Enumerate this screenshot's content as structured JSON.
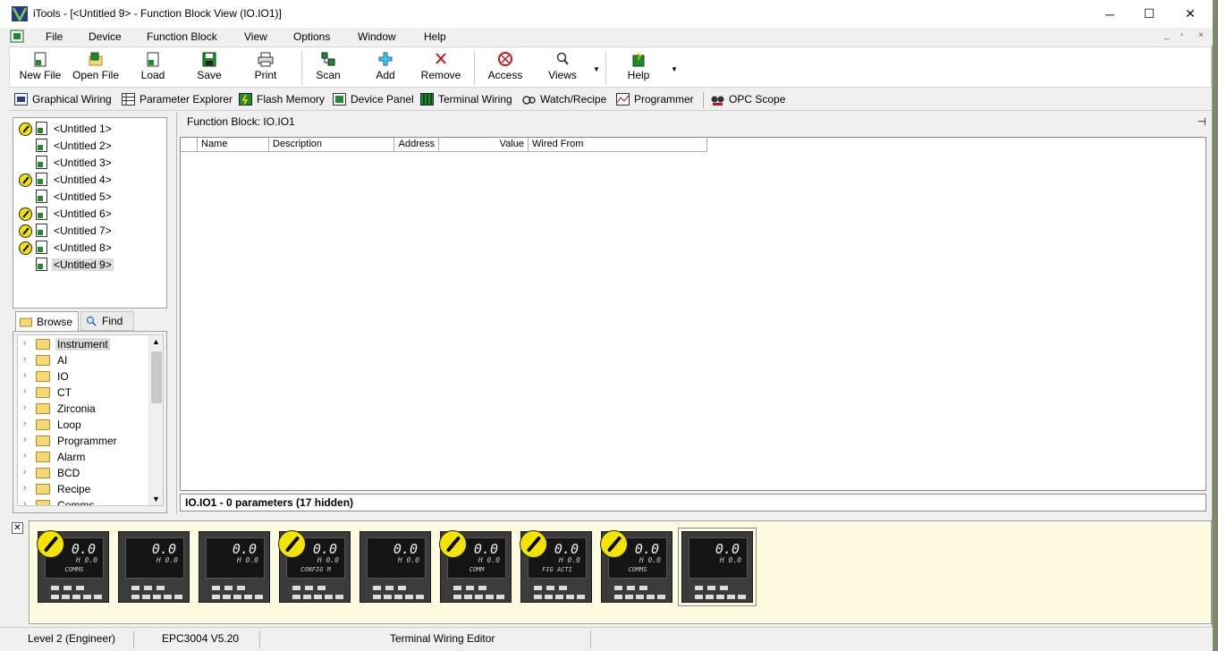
{
  "window": {
    "title": "iTools - [<Untitled 9> - Function Block View (IO.IO1)]",
    "controls": {
      "minimize": "─",
      "maximize": "☐",
      "close": "✕"
    }
  },
  "menu": {
    "items": [
      "File",
      "Device",
      "Function Block",
      "View",
      "Options",
      "Window",
      "Help"
    ],
    "mdi": {
      "minimize": "_",
      "restore": "▫",
      "close": "×"
    }
  },
  "toolbar": {
    "new_file": "New File",
    "open_file": "Open File",
    "load": "Load",
    "save": "Save",
    "print": "Print",
    "scan": "Scan",
    "add": "Add",
    "remove": "Remove",
    "access": "Access",
    "views": "Views",
    "help": "Help"
  },
  "viewbar": {
    "graphical_wiring": "Graphical Wiring",
    "parameter_explorer": "Parameter Explorer",
    "flash_memory": "Flash Memory",
    "device_panel": "Device Panel",
    "terminal_wiring": "Terminal Wiring",
    "watch_recipe": "Watch/Recipe",
    "programmer": "Programmer",
    "opc_scope": "OPC Scope"
  },
  "devices": [
    {
      "label": "<Untitled 1>",
      "wrench": true
    },
    {
      "label": "<Untitled 2>",
      "wrench": false
    },
    {
      "label": "<Untitled 3>",
      "wrench": false
    },
    {
      "label": "<Untitled 4>",
      "wrench": true
    },
    {
      "label": "<Untitled 5>",
      "wrench": false
    },
    {
      "label": "<Untitled 6>",
      "wrench": true
    },
    {
      "label": "<Untitled 7>",
      "wrench": true
    },
    {
      "label": "<Untitled 8>",
      "wrench": true
    },
    {
      "label": "<Untitled 9>",
      "wrench": false,
      "selected": true
    }
  ],
  "tabs": {
    "browse": "Browse",
    "find": "Find"
  },
  "browse_tree": [
    "Instrument",
    "AI",
    "IO",
    "CT",
    "Zirconia",
    "Loop",
    "Programmer",
    "Alarm",
    "BCD",
    "Recipe",
    "Comms"
  ],
  "function_block": {
    "header": "Function Block:  IO.IO1",
    "pin": "⊣",
    "columns": [
      "",
      "Name",
      "Description",
      "Address",
      "Value",
      "Wired From"
    ],
    "status": "IO.IO1  -  0 parameters (17 hidden)"
  },
  "instruments": [
    {
      "wrench": true,
      "pv": "0.0",
      "sp": "H 0.0",
      "msg": "COMMS"
    },
    {
      "wrench": false,
      "pv": "0.0",
      "sp": "H 0.0",
      "msg": ""
    },
    {
      "wrench": false,
      "pv": "0.0",
      "sp": "H 0.0",
      "msg": ""
    },
    {
      "wrench": true,
      "pv": "0.0",
      "sp": "H 0.0",
      "msg": "CONFIG  M"
    },
    {
      "wrench": false,
      "pv": "0.0",
      "sp": "H 0.0",
      "msg": ""
    },
    {
      "wrench": true,
      "pv": "0.0",
      "sp": "H 0.0",
      "msg": "COMM"
    },
    {
      "wrench": true,
      "pv": "0.0",
      "sp": "H 0.0",
      "msg": "FIG ACTI"
    },
    {
      "wrench": true,
      "pv": "0.0",
      "sp": "H 0.0",
      "msg": "COMMS"
    },
    {
      "wrench": false,
      "pv": "0.0",
      "sp": "H 0.0",
      "msg": "",
      "selected": true
    }
  ],
  "strip_close": "✕",
  "statusbar": {
    "access_level": "Level 2 (Engineer)",
    "device": "EPC3004 V5.20",
    "editor": "Terminal Wiring Editor"
  }
}
